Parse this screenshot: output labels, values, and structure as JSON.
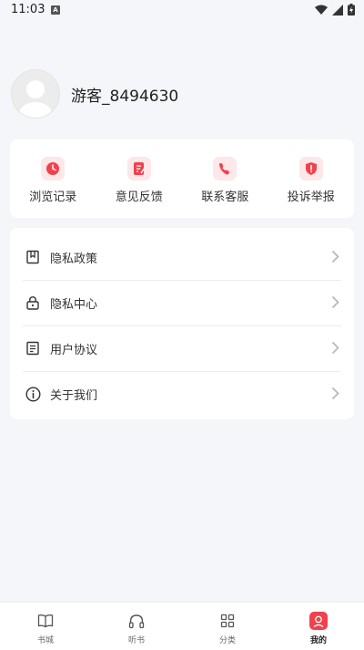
{
  "status_bar": {
    "time": "11:03",
    "notif_letter": "A"
  },
  "profile": {
    "username": "游客_8494630"
  },
  "quick_actions": [
    {
      "label": "浏览记录",
      "icon": "clock-icon"
    },
    {
      "label": "意见反馈",
      "icon": "feedback-edit-icon"
    },
    {
      "label": "联系客服",
      "icon": "phone-icon"
    },
    {
      "label": "投诉举报",
      "icon": "shield-alert-icon"
    }
  ],
  "menu": [
    {
      "label": "隐私政策",
      "icon": "bookmark-icon"
    },
    {
      "label": "隐私中心",
      "icon": "lock-icon"
    },
    {
      "label": "用户协议",
      "icon": "document-icon"
    },
    {
      "label": "关于我们",
      "icon": "info-icon"
    }
  ],
  "bottom_nav": [
    {
      "label": "书城",
      "icon": "book-icon"
    },
    {
      "label": "听书",
      "icon": "headphones-icon"
    },
    {
      "label": "分类",
      "icon": "grid-icon"
    },
    {
      "label": "我的",
      "icon": "user-icon"
    }
  ],
  "colors": {
    "accent": "#f0414d",
    "accent_light": "#fde7e8",
    "background": "#f5f6fa"
  }
}
